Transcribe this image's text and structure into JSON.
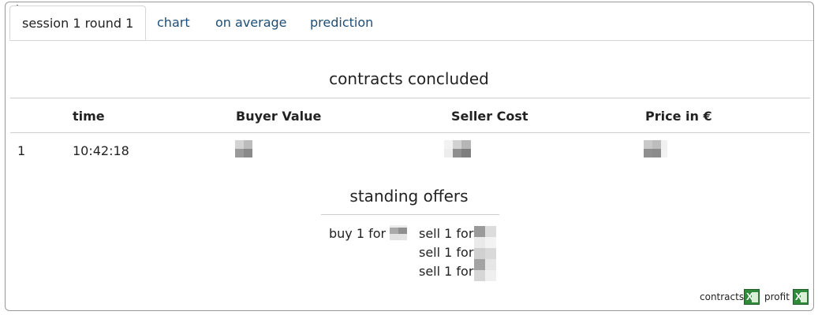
{
  "tabs": [
    {
      "label": "session 1 round 1"
    },
    {
      "label": "chart"
    },
    {
      "label": "on average"
    },
    {
      "label": "prediction"
    }
  ],
  "contracts": {
    "title": "contracts concluded",
    "headers": [
      "",
      "time",
      "Buyer Value",
      "Seller Cost",
      "Price in €"
    ],
    "rows": [
      {
        "index": "1",
        "time": "10:42:18"
      }
    ]
  },
  "offers": {
    "title": "standing offers",
    "buy": [
      "buy 1 for"
    ],
    "sell": [
      "sell 1 for",
      "sell 1 for",
      "sell 1 for"
    ]
  },
  "footer": {
    "contracts_label": "contracts",
    "profit_label": "profit",
    "icon": "excel-export-icon"
  }
}
